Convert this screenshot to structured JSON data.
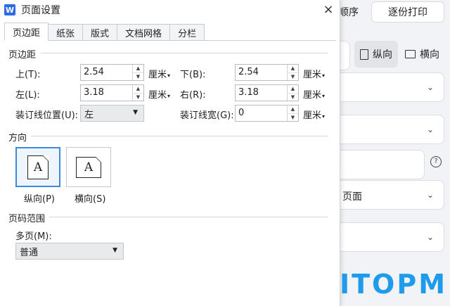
{
  "background": {
    "order_label": "顺序",
    "collate_label": "逐份打印",
    "portrait_label": "纵向",
    "landscape_label": "横向",
    "pages_label": "页面",
    "help_glyph": "?"
  },
  "dialog": {
    "app_icon": "W",
    "title": "页面设置",
    "close_glyph": "×",
    "tabs": [
      "页边距",
      "纸张",
      "版式",
      "文档网格",
      "分栏"
    ],
    "active_tab": 0,
    "margins": {
      "section_title": "页边距",
      "top_label": "上(T):",
      "top_value": "2.54",
      "bottom_label": "下(B):",
      "bottom_value": "2.54",
      "left_label": "左(L):",
      "left_value": "3.18",
      "right_label": "右(R):",
      "right_value": "3.18",
      "gutter_pos_label": "装订线位置(U):",
      "gutter_pos_value": "左",
      "gutter_width_label": "装订线宽(G):",
      "gutter_width_value": "0",
      "unit": "厘米"
    },
    "orientation": {
      "section_title": "方向",
      "glyph": "A",
      "portrait_label": "纵向(P)",
      "landscape_label": "横向(S)",
      "selected": "portrait"
    },
    "pages": {
      "section_title": "页码范围",
      "multiple_label": "多页(M):",
      "multiple_value": "普通"
    }
  },
  "watermark": "ITOPM",
  "colors": {
    "accent": "#3d8ad8",
    "watermark": "#1e9bea",
    "word_icon": "#2d6be4"
  }
}
